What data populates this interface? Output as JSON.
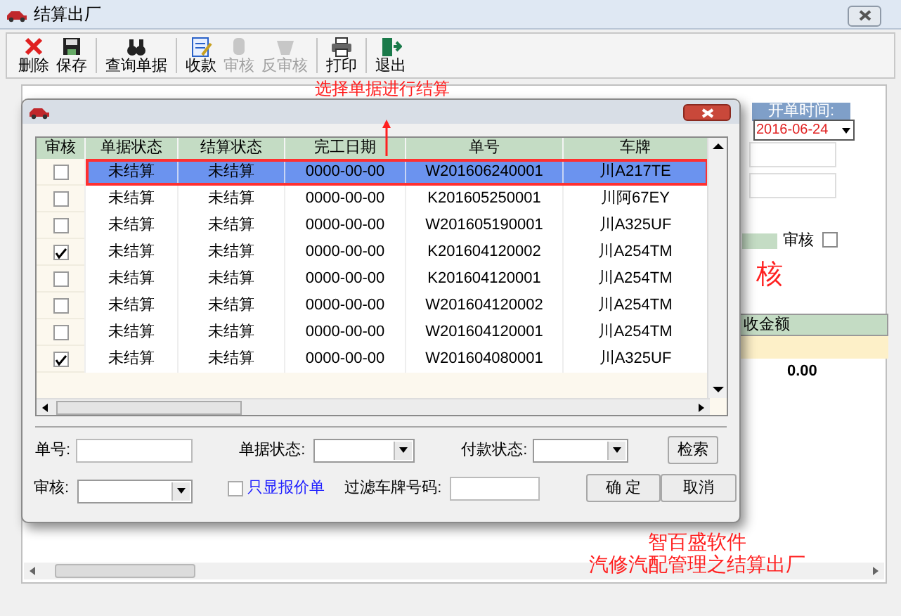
{
  "window": {
    "title": "结算出厂"
  },
  "toolbar": [
    {
      "label": "删除",
      "disabled": false
    },
    {
      "label": "保存",
      "disabled": false
    },
    {
      "label": "查询单据",
      "disabled": false
    },
    {
      "label": "收款",
      "disabled": false
    },
    {
      "label": "审核",
      "disabled": true
    },
    {
      "label": "反审核",
      "disabled": true
    },
    {
      "label": "打印",
      "disabled": false
    },
    {
      "label": "退出",
      "disabled": false
    }
  ],
  "main_form": {
    "date_header": "开单时间:",
    "date_value": "2016-06-24",
    "audit_label": "审核",
    "audit_checked": false,
    "audit_stamp": "核",
    "amount_header": "收金额",
    "amount": "0.00"
  },
  "dialog": {
    "columns": [
      "审核",
      "单据状态",
      "结算状态",
      "完工日期",
      "单号",
      "车牌"
    ],
    "rows": [
      {
        "checked": false,
        "selected": true,
        "status": "未结算",
        "settle": "未结算",
        "date": "0000-00-00",
        "number": "W201606240001",
        "plate": "川A217TE"
      },
      {
        "checked": false,
        "selected": false,
        "status": "未结算",
        "settle": "未结算",
        "date": "0000-00-00",
        "number": "K201605250001",
        "plate": "川阿67EY"
      },
      {
        "checked": false,
        "selected": false,
        "status": "未结算",
        "settle": "未结算",
        "date": "0000-00-00",
        "number": "W201605190001",
        "plate": "川A325UF"
      },
      {
        "checked": true,
        "selected": false,
        "status": "未结算",
        "settle": "未结算",
        "date": "0000-00-00",
        "number": "K201604120002",
        "plate": "川A254TM"
      },
      {
        "checked": false,
        "selected": false,
        "status": "未结算",
        "settle": "未结算",
        "date": "0000-00-00",
        "number": "K201604120001",
        "plate": "川A254TM"
      },
      {
        "checked": false,
        "selected": false,
        "status": "未结算",
        "settle": "未结算",
        "date": "0000-00-00",
        "number": "W201604120002",
        "plate": "川A254TM"
      },
      {
        "checked": false,
        "selected": false,
        "status": "未结算",
        "settle": "未结算",
        "date": "0000-00-00",
        "number": "W201604120001",
        "plate": "川A254TM"
      },
      {
        "checked": true,
        "selected": false,
        "status": "未结算",
        "settle": "未结算",
        "date": "0000-00-00",
        "number": "W201604080001",
        "plate": "川A325UF"
      }
    ],
    "filters": {
      "number_label": "单号:",
      "doc_status_label": "单据状态:",
      "pay_status_label": "付款状态:",
      "audit_label": "审核:",
      "quote_only_label": "只显报价单",
      "quote_only_checked": false,
      "plate_filter_label": "过滤车牌号码:"
    },
    "buttons": {
      "search": "检索",
      "ok": "确 定",
      "cancel": "取消"
    }
  },
  "annotations": {
    "hint": "选择单据进行结算",
    "brand": "智百盛软件",
    "caption": "汽修汽配管理之结算出厂"
  }
}
